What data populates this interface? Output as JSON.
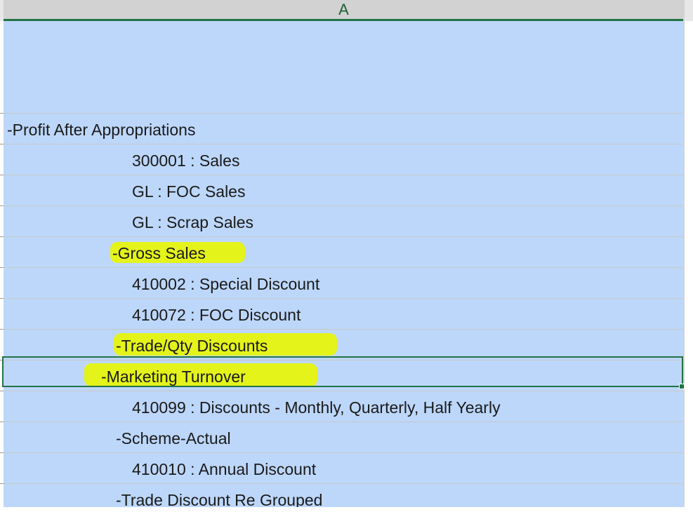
{
  "spreadsheet": {
    "column_header": "A",
    "selected_row_index": 8,
    "accent_color": "#217346",
    "cell_fill_color": "#bdd7fa",
    "highlight_color": "#e4f31a",
    "rows": [
      {
        "text": "-Profit After Appropriations",
        "highlighted": false
      },
      {
        "text": "300001 : Sales",
        "highlighted": false
      },
      {
        "text": "GL : FOC Sales",
        "highlighted": false
      },
      {
        "text": "GL : Scrap Sales",
        "highlighted": false
      },
      {
        "text": "-Gross Sales",
        "highlighted": true
      },
      {
        "text": "410002 : Special Discount",
        "highlighted": false
      },
      {
        "text": "410072 : FOC Discount",
        "highlighted": false
      },
      {
        "text": "-Trade/Qty Discounts",
        "highlighted": true
      },
      {
        "text": "-Marketing Turnover",
        "highlighted": true
      },
      {
        "text": "410099 : Discounts - Monthly, Quarterly, Half Yearly",
        "highlighted": false
      },
      {
        "text": "-Scheme-Actual",
        "highlighted": false
      },
      {
        "text": "410010 : Annual Discount",
        "highlighted": false
      },
      {
        "text": "-Trade Discount Re Grouped",
        "highlighted": false
      }
    ]
  }
}
